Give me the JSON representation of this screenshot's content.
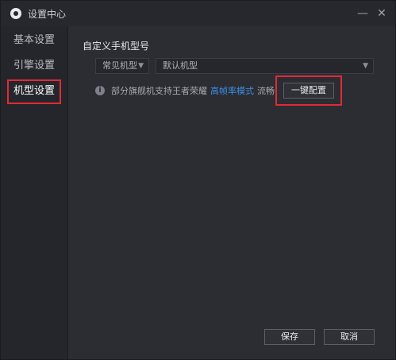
{
  "window": {
    "title": "设置中心",
    "minimize": "—",
    "close": "✕"
  },
  "sidebar": {
    "items": [
      {
        "label": "基本设置"
      },
      {
        "label": "引擎设置"
      },
      {
        "label": "机型设置"
      }
    ],
    "active_index": 2
  },
  "main": {
    "section_title": "自定义手机型号",
    "type_select": {
      "value": "常见机型",
      "arrow": "▼"
    },
    "model_select": {
      "value": "默认机型",
      "arrow": "▼"
    },
    "info": {
      "icon": "i",
      "text_before": "部分旗舰机支持王者荣耀",
      "link": "高帧率模式",
      "text_after": "流畅"
    },
    "one_click_button": "一键配置"
  },
  "footer": {
    "save": "保存",
    "cancel": "取消"
  },
  "colors": {
    "highlight_red": "#e02b36",
    "link_blue": "#3d8fe8",
    "panel_bg": "#2b2d33"
  }
}
